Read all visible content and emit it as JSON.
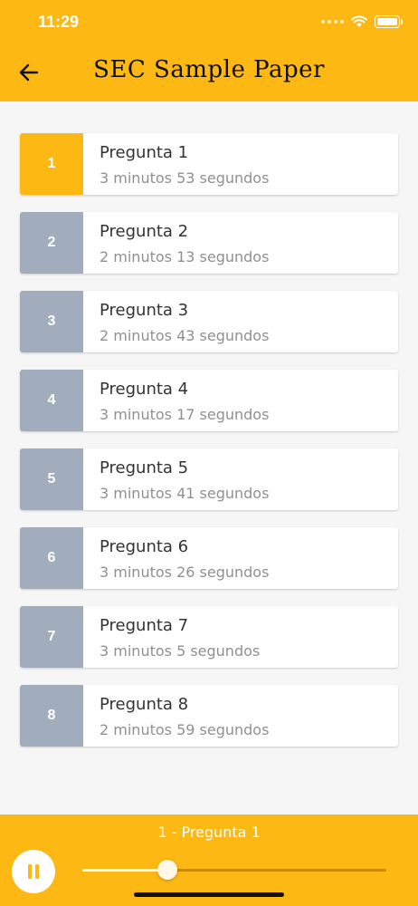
{
  "status_bar": {
    "time": "11:29"
  },
  "header": {
    "title": "SEC Sample Paper"
  },
  "questions": [
    {
      "number": "1",
      "title": "Pregunta 1",
      "duration": "3 minutos 53 segundos",
      "active": true
    },
    {
      "number": "2",
      "title": "Pregunta 2",
      "duration": "2 minutos 13 segundos",
      "active": false
    },
    {
      "number": "3",
      "title": "Pregunta 3",
      "duration": "2 minutos 43 segundos",
      "active": false
    },
    {
      "number": "4",
      "title": "Pregunta 4",
      "duration": "3 minutos 17 segundos",
      "active": false
    },
    {
      "number": "5",
      "title": "Pregunta 5",
      "duration": "3 minutos 41 segundos",
      "active": false
    },
    {
      "number": "6",
      "title": "Pregunta 6",
      "duration": "3 minutos 26 segundos",
      "active": false
    },
    {
      "number": "7",
      "title": "Pregunta 7",
      "duration": "3 minutos 5 segundos",
      "active": false
    },
    {
      "number": "8",
      "title": "Pregunta 8",
      "duration": "2 minutos 59 segundos",
      "active": false
    }
  ],
  "player": {
    "now_playing": "1 - Pregunta 1",
    "progress": 0.28,
    "state": "playing"
  },
  "colors": {
    "accent": "#fdb813",
    "inactive_badge": "#a1adbd"
  },
  "icons": {
    "back": "arrow-left-icon",
    "pause": "pause-icon",
    "wifi": "wifi-icon",
    "battery": "battery-icon",
    "signal": "signal-dots-icon"
  }
}
